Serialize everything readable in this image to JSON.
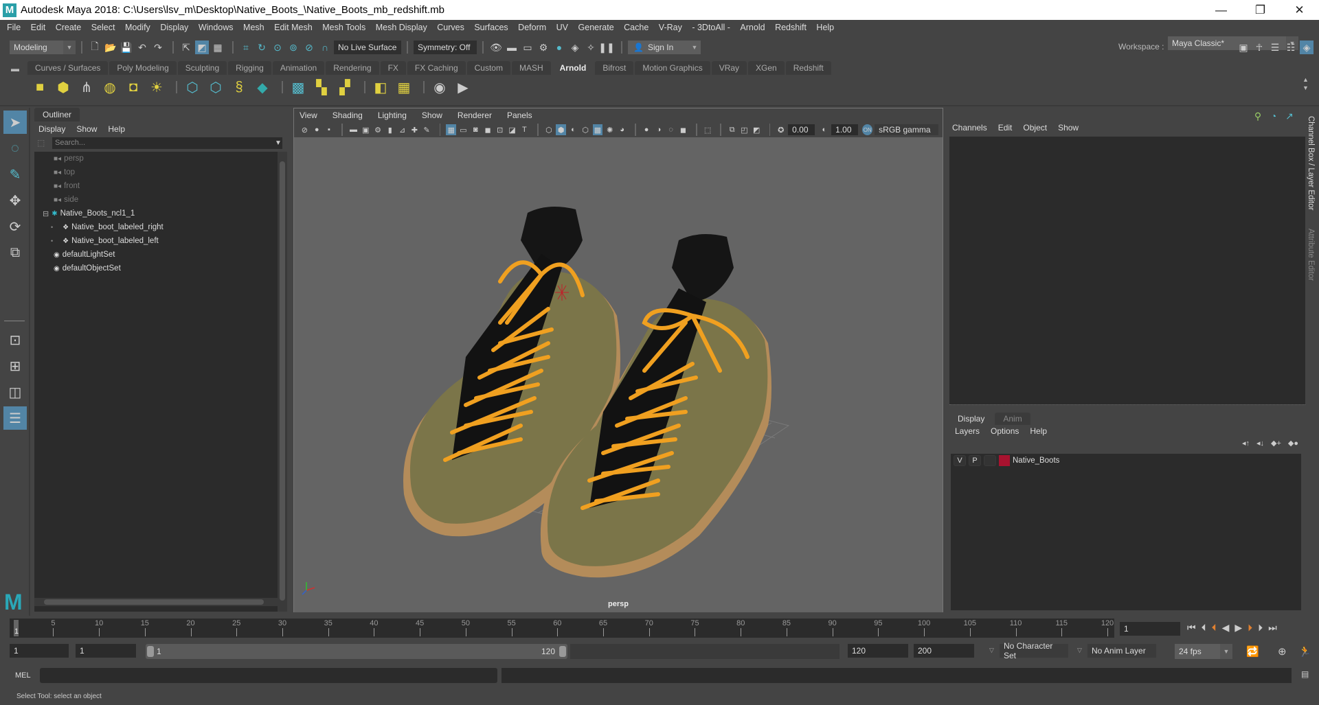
{
  "window": {
    "title": "Autodesk Maya 2018: C:\\Users\\lsv_m\\Desktop\\Native_Boots_\\Native_Boots_mb_redshift.mb",
    "minimize": "—",
    "maximize": "❐",
    "close": "✕"
  },
  "menubar": [
    "File",
    "Edit",
    "Create",
    "Select",
    "Modify",
    "Display",
    "Windows",
    "Mesh",
    "Edit Mesh",
    "Mesh Tools",
    "Mesh Display",
    "Curves",
    "Surfaces",
    "Deform",
    "UV",
    "Generate",
    "Cache",
    "V-Ray",
    "- 3DtoAll -",
    "Arnold",
    "Redshift",
    "Help"
  ],
  "statusline": {
    "mode": "Modeling",
    "live_surface": "No Live Surface",
    "symmetry": "Symmetry: Off",
    "sign_in": "Sign In",
    "workspace_label": "Workspace :",
    "workspace_value": "Maya Classic*"
  },
  "shelf": {
    "tabs": [
      "Curves / Surfaces",
      "Poly Modeling",
      "Sculpting",
      "Rigging",
      "Animation",
      "Rendering",
      "FX",
      "FX Caching",
      "Custom",
      "MASH",
      "Arnold",
      "Bifrost",
      "Motion Graphics",
      "VRay",
      "XGen",
      "Redshift"
    ],
    "active_tab": "Arnold"
  },
  "outliner": {
    "tab": "Outliner",
    "menu": [
      "Display",
      "Show",
      "Help"
    ],
    "search_placeholder": "Search...",
    "items": [
      {
        "label": "persp",
        "icon": "camera-icon",
        "dim": true,
        "indent": 1
      },
      {
        "label": "top",
        "icon": "camera-icon",
        "dim": true,
        "indent": 1
      },
      {
        "label": "front",
        "icon": "camera-icon",
        "dim": true,
        "indent": 1
      },
      {
        "label": "side",
        "icon": "camera-icon",
        "dim": true,
        "indent": 1
      },
      {
        "label": "Native_Boots_ncl1_1",
        "icon": "group-icon",
        "dim": false,
        "indent": 1
      },
      {
        "label": "Native_boot_labeled_right",
        "icon": "mesh-icon",
        "dim": false,
        "indent": 2
      },
      {
        "label": "Native_boot_labeled_left",
        "icon": "mesh-icon",
        "dim": false,
        "indent": 2
      },
      {
        "label": "defaultLightSet",
        "icon": "set-icon",
        "dim": false,
        "indent": 1
      },
      {
        "label": "defaultObjectSet",
        "icon": "set-icon",
        "dim": false,
        "indent": 1
      }
    ]
  },
  "viewport": {
    "menu": [
      "View",
      "Shading",
      "Lighting",
      "Show",
      "Renderer",
      "Panels"
    ],
    "exposure": "0.00",
    "gamma": "1.00",
    "color_space": "sRGB gamma",
    "camera_label": "persp"
  },
  "channel_box": {
    "menu": [
      "Channels",
      "Edit",
      "Object",
      "Show"
    ]
  },
  "layer_editor": {
    "tabs": [
      "Display",
      "Anim"
    ],
    "active_tab": "Display",
    "menu": [
      "Layers",
      "Options",
      "Help"
    ],
    "layers": [
      {
        "v": "V",
        "p": "P",
        "name": "Native_Boots",
        "color": "#a8122f"
      }
    ]
  },
  "side_tabs": [
    "Channel Box / Layer Editor",
    "Attribute Editor"
  ],
  "timeline": {
    "ticks": [
      5,
      10,
      15,
      20,
      25,
      30,
      35,
      40,
      45,
      50,
      55,
      60,
      65,
      70,
      75,
      80,
      85,
      90,
      95,
      100,
      105,
      110,
      115,
      120
    ],
    "start": 1,
    "end": 120,
    "current_frame": "1"
  },
  "range": {
    "start": "1",
    "anim_start": "1",
    "slider_start": "1",
    "slider_end": "120",
    "anim_end": "120",
    "end": "200",
    "character_set": "No Character Set",
    "anim_layer": "No Anim Layer",
    "fps": "24 fps"
  },
  "command_line": {
    "label": "MEL"
  },
  "help_line": "Select Tool: select an object"
}
